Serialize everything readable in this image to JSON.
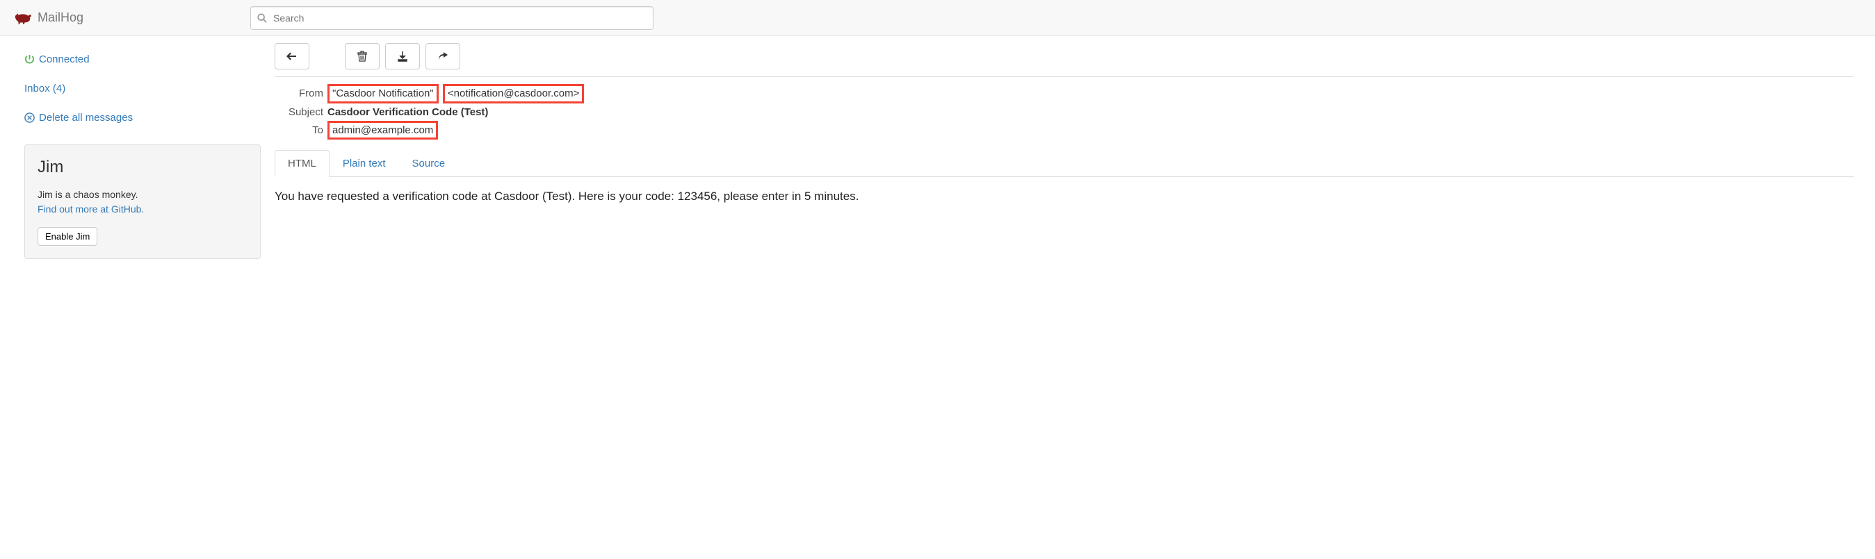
{
  "navbar": {
    "brand": "MailHog",
    "search_placeholder": "Search"
  },
  "sidebar": {
    "status_label": "Connected",
    "inbox_label": "Inbox (4)",
    "delete_all_label": "Delete all messages"
  },
  "jim": {
    "title": "Jim",
    "desc": "Jim is a chaos monkey.",
    "link_text": "Find out more at GitHub.",
    "button_label": "Enable Jim"
  },
  "message": {
    "from_label": "From",
    "from_name": "\"Casdoor Notification\"",
    "from_email": "<notification@casdoor.com>",
    "subject_label": "Subject",
    "subject": "Casdoor Verification Code (Test)",
    "to_label": "To",
    "to": "admin@example.com",
    "body": "You have requested a verification code at Casdoor (Test). Here is your code: 123456, please enter in 5 minutes."
  },
  "tabs": {
    "html": "HTML",
    "plain": "Plain text",
    "source": "Source"
  }
}
